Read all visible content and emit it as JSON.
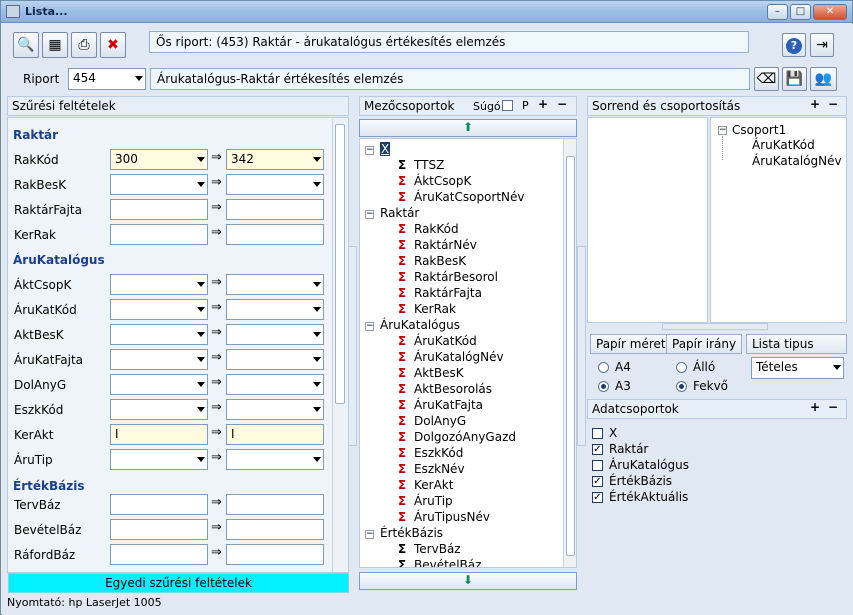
{
  "window": {
    "title": "Lista..."
  },
  "toolbar": {
    "source_report": "Ős riport: (453)  Raktár - árukatalógus értékesítés elemzés"
  },
  "report": {
    "label": "Riport",
    "number": "454",
    "name": "Árukatalógus-Raktár értékesítés elemzés"
  },
  "filters": {
    "header": "Szűrési feltételek",
    "footer": "Egyedi szűrési feltételek",
    "sections": {
      "raktar": "Raktár",
      "arukatalogus": "ÁruKatalógus",
      "ertekbazis": "ÉrtékBázis"
    },
    "rows": [
      {
        "label": "RakKód",
        "from": "300",
        "to": "342"
      },
      {
        "label": "RakBesK",
        "from": "",
        "to": ""
      },
      {
        "label": "RaktárFajta",
        "from": "",
        "to": ""
      },
      {
        "label": "KerRak",
        "from": "",
        "to": ""
      },
      {
        "label": "ÁktCsopK",
        "from": "",
        "to": ""
      },
      {
        "label": "ÁruKatKód",
        "from": "",
        "to": ""
      },
      {
        "label": "AktBesK",
        "from": "",
        "to": ""
      },
      {
        "label": "ÁruKatFajta",
        "from": "",
        "to": ""
      },
      {
        "label": "DolAnyG",
        "from": "",
        "to": ""
      },
      {
        "label": "EszkKód",
        "from": "",
        "to": ""
      },
      {
        "label": "KerAkt",
        "from": "I",
        "to": "I"
      },
      {
        "label": "ÁruTip",
        "from": "",
        "to": ""
      },
      {
        "label": "TervBáz",
        "from": "",
        "to": ""
      },
      {
        "label": "BevételBáz",
        "from": "",
        "to": ""
      },
      {
        "label": "RáfordBáz",
        "from": "",
        "to": ""
      }
    ]
  },
  "fields": {
    "header": "Mezőcsoportok",
    "help": "Súgó",
    "p": "P",
    "items": [
      "X",
      "TTSZ",
      "ÁktCsopK",
      "ÁruKatCsoportNév",
      "Raktár",
      "RakKód",
      "RaktárNév",
      "RakBesK",
      "RaktárBesorol",
      "RaktárFajta",
      "KerRak",
      "ÁruKatalógus",
      "ÁruKatKód",
      "ÁruKatalógNév",
      "AktBesK",
      "AktBesorolás",
      "ÁruKatFajta",
      "DolAnyG",
      "DolgozóAnyGazd",
      "EszkKód",
      "EszkNév",
      "KerAkt",
      "ÁruTip",
      "ÁruTipusNév",
      "ÉrtékBázis",
      "TervBáz",
      "BevételBáz"
    ]
  },
  "order": {
    "header": "Sorrend és csoportosítás",
    "group": "Csoport1",
    "items": [
      "ÁruKatKód",
      "ÁruKatalógNév"
    ]
  },
  "paper": {
    "size_label": "Papír méret",
    "dir_label": "Papír irány",
    "list_label": "Lista tipus",
    "a4": "A4",
    "a3": "A3",
    "allo": "Álló",
    "fekvo": "Fekvő",
    "list_type": "Tételes"
  },
  "datagroups": {
    "header": "Adatcsoportok",
    "items": [
      {
        "label": "X",
        "checked": false
      },
      {
        "label": "Raktár",
        "checked": true
      },
      {
        "label": "ÁruKatalógus",
        "checked": false
      },
      {
        "label": "ÉrtékBázis",
        "checked": true
      },
      {
        "label": "ÉrtékAktuális",
        "checked": true
      }
    ]
  },
  "status": {
    "printer": "Nyomtató: hp LaserJet 1005"
  }
}
